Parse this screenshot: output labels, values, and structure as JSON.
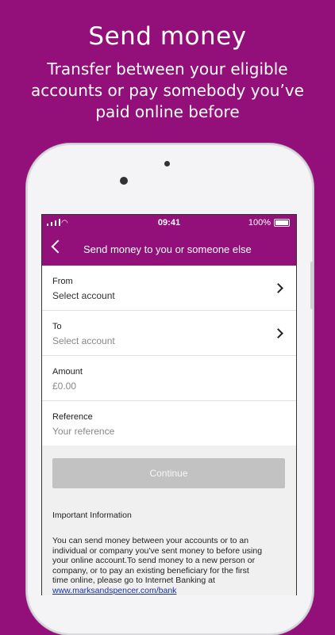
{
  "promo": {
    "title": "Send money",
    "subtitle": "Transfer between your eligible accounts or pay somebody you’ve paid online before"
  },
  "status_bar": {
    "time": "09:41",
    "battery": "100%"
  },
  "nav": {
    "title": "Send money to you or someone else",
    "back_icon": "chevron-left-icon"
  },
  "form": {
    "from": {
      "label": "From",
      "value": "Select account"
    },
    "to": {
      "label": "To",
      "value": "Select account"
    },
    "amount": {
      "label": "Amount",
      "placeholder": "£0.00"
    },
    "reference": {
      "label": "Reference",
      "placeholder": "Your reference"
    }
  },
  "actions": {
    "continue_label": "Continue"
  },
  "info": {
    "heading": "Important Information",
    "body": "You can send money between your accounts or to an individual or company you've sent money to before using your online account.To send money to a new person or company, or to pay an existing beneficiary for the first time online, please go to Internet Banking at",
    "link": "www.marksandspencer.com/bank"
  },
  "colors": {
    "brand": "#93107a",
    "button_disabled": "#c2c2c2",
    "link": "#1a2ea6"
  }
}
